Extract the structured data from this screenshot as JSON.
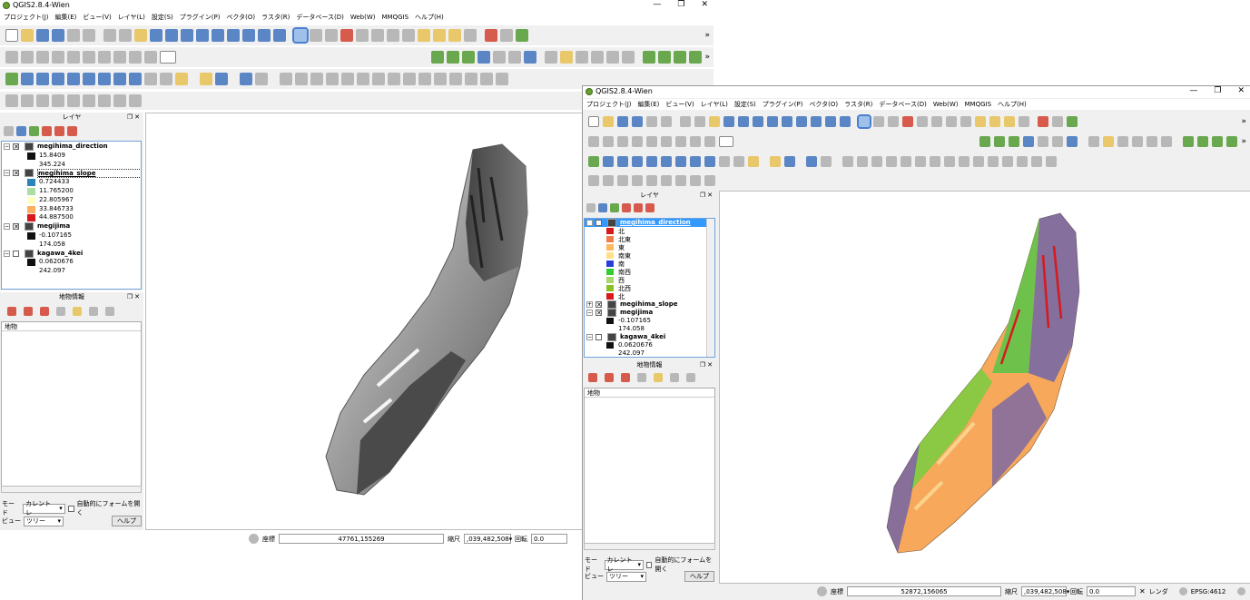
{
  "w1": {
    "title": "QGIS2.8.4-Wien",
    "menu": [
      "プロジェクト(J)",
      "編集(E)",
      "ビュー(V)",
      "レイヤ(L)",
      "設定(S)",
      "プラグイン(P)",
      "ベクタ(O)",
      "ラスタ(R)",
      "データベース(D)",
      "Web(W)",
      "MMQGIS",
      "ヘルプ(H)"
    ],
    "layers_title": "レイヤ",
    "features_title": "地物情報",
    "feature_col": "地物",
    "layers": [
      {
        "name": "megihima_direction",
        "values": [
          "15.8409",
          "345.224"
        ]
      },
      {
        "name": "megihima_slope",
        "values": [
          "0.724433",
          "11.765200",
          "22.805967",
          "33.846733",
          "44.887500"
        ]
      },
      {
        "name": "megijima",
        "values": [
          "-0.107165",
          "174.058"
        ]
      },
      {
        "name": "kagawa_4kei",
        "values": [
          "0.0620676",
          "242.097"
        ]
      }
    ],
    "mode_label": "モード",
    "mode_value": "カレントレ",
    "auto_form": "自動的にフォームを開く",
    "view_label": "ビュー",
    "view_value": "ツリー",
    "help": "ヘルプ",
    "coord_label": "座標",
    "coord_value": "47761,155269",
    "scale_label": "縮尺",
    "scale_value": ",039,482,508",
    "rotation_label": "回転",
    "rotation_value": "0.0"
  },
  "w2": {
    "title": "QGIS2.8.4-Wien",
    "menu": [
      "プロジェクト(J)",
      "編集(E)",
      "ビュー(V)",
      "レイヤ(L)",
      "設定(S)",
      "プラグイン(P)",
      "ベクタ(O)",
      "ラスタ(R)",
      "データベース(D)",
      "Web(W)",
      "MMQGIS",
      "ヘルプ(H)"
    ],
    "layers_title": "レイヤ",
    "features_title": "地物情報",
    "feature_col": "地物",
    "direction_layer": "megihima_direction",
    "directions": [
      {
        "label": "北",
        "color": "#d7191c"
      },
      {
        "label": "北東",
        "color": "#f07c4a"
      },
      {
        "label": "東",
        "color": "#fdb863"
      },
      {
        "label": "南東",
        "color": "#fee08b"
      },
      {
        "label": "南",
        "color": "#2b3ed6"
      },
      {
        "label": "南西",
        "color": "#33cc33"
      },
      {
        "label": "西",
        "color": "#a6d96a"
      },
      {
        "label": "北西",
        "color": "#8cbf26"
      },
      {
        "label": "北",
        "color": "#d7191c"
      }
    ],
    "other_layers": [
      {
        "name": "megihima_slope",
        "values": []
      },
      {
        "name": "megijima",
        "values": [
          "-0.107165",
          "174.058"
        ]
      },
      {
        "name": "kagawa_4kei",
        "values": [
          "0.0620676",
          "242.097"
        ]
      }
    ],
    "mode_label": "モード",
    "mode_value": "カレントレ",
    "auto_form": "自動的にフォームを開く",
    "view_label": "ビュー",
    "view_value": "ツリー",
    "help": "ヘルプ",
    "coord_label": "座標",
    "coord_value": "52872,156065",
    "scale_label": "縮尺",
    "scale_value": ",039,482,508",
    "rotation_label": "回転",
    "rotation_value": "0.0",
    "render_label": "レンダ",
    "crs": "EPSG:4612"
  },
  "window_controls": [
    "—",
    "❐",
    "✕"
  ],
  "toolbar_icons": [
    "new-project-icon",
    "open-project-icon",
    "save-project-icon",
    "pan-icon",
    "zoom-in-icon",
    "zoom-out-icon",
    "identify-icon",
    "select-icon",
    "python-icon",
    "help-icon"
  ]
}
